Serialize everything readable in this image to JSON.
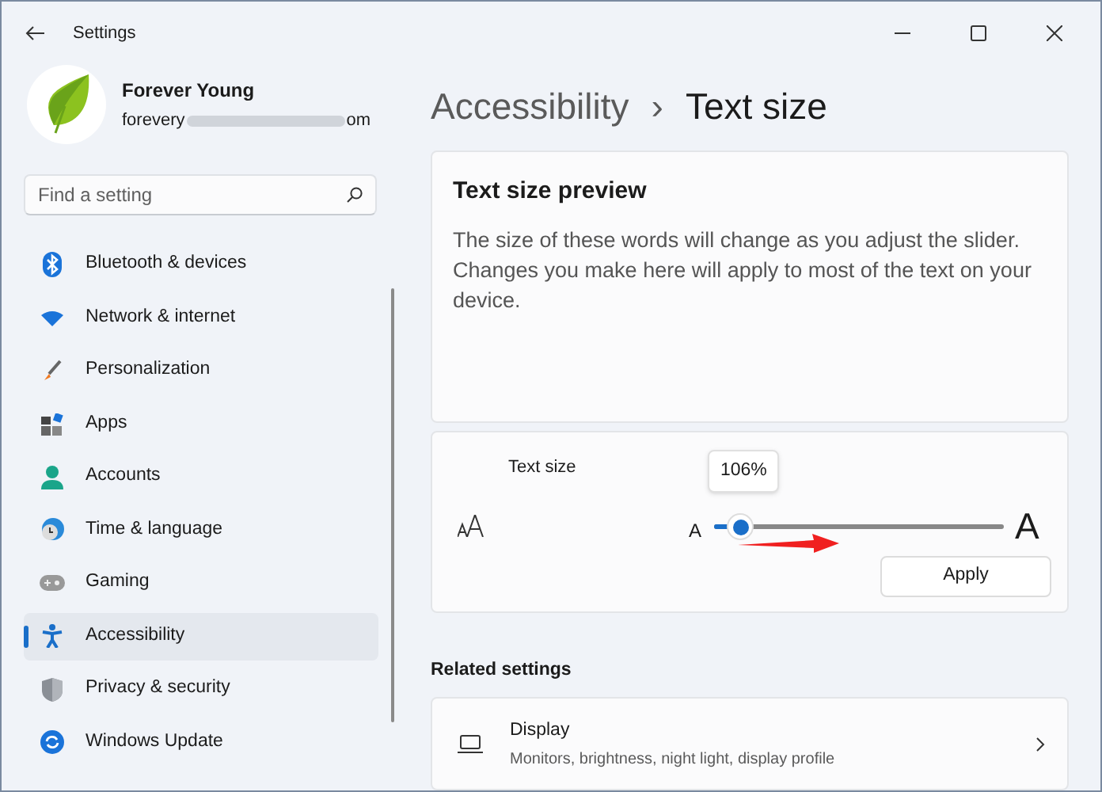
{
  "window": {
    "title": "Settings"
  },
  "profile": {
    "name": "Forever Young",
    "email_start": "forevery",
    "email_end": "om"
  },
  "search": {
    "placeholder": "Find a setting"
  },
  "sidebar": {
    "items": [
      {
        "label": "Bluetooth & devices",
        "selected": false
      },
      {
        "label": "Network & internet",
        "selected": false
      },
      {
        "label": "Personalization",
        "selected": false
      },
      {
        "label": "Apps",
        "selected": false
      },
      {
        "label": "Accounts",
        "selected": false
      },
      {
        "label": "Time & language",
        "selected": false
      },
      {
        "label": "Gaming",
        "selected": false
      },
      {
        "label": "Accessibility",
        "selected": true
      },
      {
        "label": "Privacy & security",
        "selected": false
      },
      {
        "label": "Windows Update",
        "selected": false
      }
    ]
  },
  "breadcrumb": {
    "parent": "Accessibility",
    "separator": "›",
    "current": "Text size"
  },
  "preview": {
    "title": "Text size preview",
    "body": "The size of these words will change as you adjust the slider. Changes you make here will apply to most of the text on your device."
  },
  "text_size": {
    "label": "Text size",
    "tooltip": "106%",
    "small_a": "A",
    "large_a": "A",
    "level": 0.09,
    "apply": "Apply"
  },
  "related": {
    "heading": "Related settings",
    "items": [
      {
        "title": "Display",
        "subtitle": "Monitors, brightness, night light, display profile"
      }
    ]
  }
}
